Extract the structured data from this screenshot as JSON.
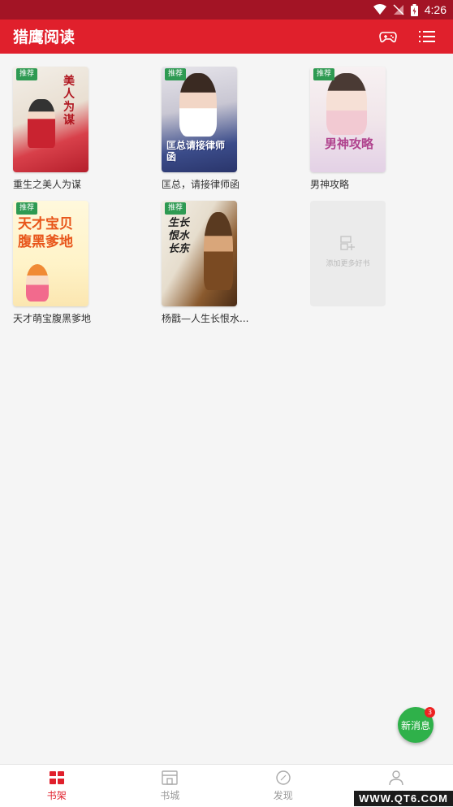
{
  "status_bar": {
    "time": "4:26"
  },
  "app": {
    "title": "猎鹰阅读"
  },
  "books": [
    {
      "title": "重生之美人为谋",
      "tag": "推荐",
      "cover_text": "美人为谋"
    },
    {
      "title": "匡总，请接律师函",
      "tag": "推荐",
      "cover_text": "匡总请接律师函"
    },
    {
      "title": "男神攻略",
      "tag": "推荐",
      "cover_text": "男神攻略"
    },
    {
      "title": "天才萌宝腹黑爹地",
      "tag": "推荐",
      "cover_text": "天才宝贝腹黑爹地"
    },
    {
      "title": "杨戬—人生长恨水...",
      "tag": "推荐",
      "cover_text": "生长恨水长东"
    }
  ],
  "add_more": {
    "label": "添加更多好书"
  },
  "fab": {
    "label": "新消息",
    "badge": "3"
  },
  "nav": [
    {
      "label": "书架",
      "icon": "bookshelf-icon",
      "active": true
    },
    {
      "label": "书城",
      "icon": "store-icon",
      "active": false
    },
    {
      "label": "发现",
      "icon": "compass-icon",
      "active": false
    },
    {
      "label": "我的",
      "icon": "user-icon",
      "active": false
    }
  ],
  "watermark": "WWW.QT6.COM",
  "colors": {
    "accent": "#e0202c",
    "status_bar": "#a31425",
    "tag": "#2e9a52",
    "fab": "#2fb14a"
  }
}
